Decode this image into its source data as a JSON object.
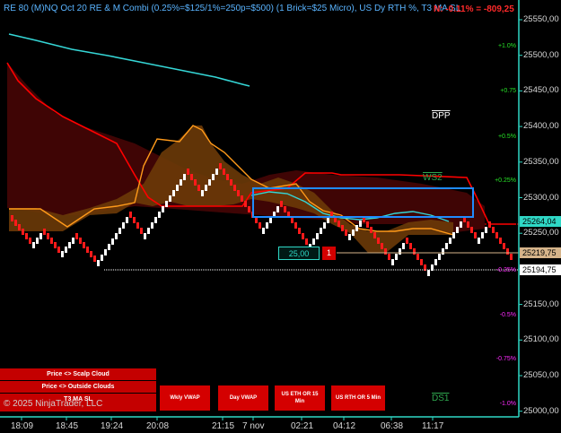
{
  "header": {
    "title": "RE 80 (M)NQ Oct 20 RE & M Combi (0.25%=$125/1%=250p=$500)  (1 Brick=$25 Micro), US Dy RTH %, T3 MA SL",
    "pnl": "N: -0.11% = -809,25"
  },
  "copyright": "© 2025 NinjaTrader, LLC",
  "left_panel": {
    "items": [
      "Price <> Scalp Cloud",
      "Price <> Outside Clouds",
      "T3 MA SL"
    ]
  },
  "toggle_buttons": [
    "Wkly VWAP",
    "Day VWAP",
    "US ETH OR 15 Min",
    "US RTH OR 5 Min"
  ],
  "order_widget": {
    "quantity": "25,00",
    "close_label": "1"
  },
  "levels": {
    "dpp": "DPP",
    "ws2": "WS2",
    "ds1": "DS1"
  },
  "price_axis": {
    "ticks": [
      "25550,00",
      "25500,00",
      "25450,00",
      "25400,00",
      "25350,00",
      "25300,00",
      "25250,00",
      "25200,00",
      "25150,00",
      "25100,00",
      "25050,00",
      "25000,00"
    ],
    "markers": [
      {
        "label": "25264,04",
        "color": "#2fd8c6",
        "text_color": "#000"
      },
      {
        "label": "25219,75",
        "color": "#d6b48a",
        "text_color": "#000"
      },
      {
        "label": "25194,75",
        "color": "#ffffff",
        "text_color": "#000"
      }
    ]
  },
  "pct_axis": {
    "ticks": [
      "+1.0%",
      "+0.75",
      "+0.5%",
      "+0.25%",
      "-0.25%",
      "-0.5%",
      "-0.75%",
      "-1.0%"
    ],
    "colors": {
      "positive": "#27e327",
      "negative": "#ff2aff"
    }
  },
  "time_axis": {
    "ticks": [
      "18:09",
      "18:45",
      "19:24",
      "20:08",
      "21:15",
      "7 nov",
      "02:21",
      "04:12",
      "06:38",
      "11:17"
    ]
  },
  "colors": {
    "background": "#000000",
    "axis_line": "#2fd8c6",
    "up_brick": "#ffffff",
    "down_brick": "#ff1a1a",
    "red_line": "#ff0000",
    "orange_line": "#ff9a1a",
    "cyan_line": "#35d6d6",
    "cloud_brown": "#6b3a08",
    "cloud_dark_red": "#4a0606",
    "box_blue": "#1f8cff"
  }
}
